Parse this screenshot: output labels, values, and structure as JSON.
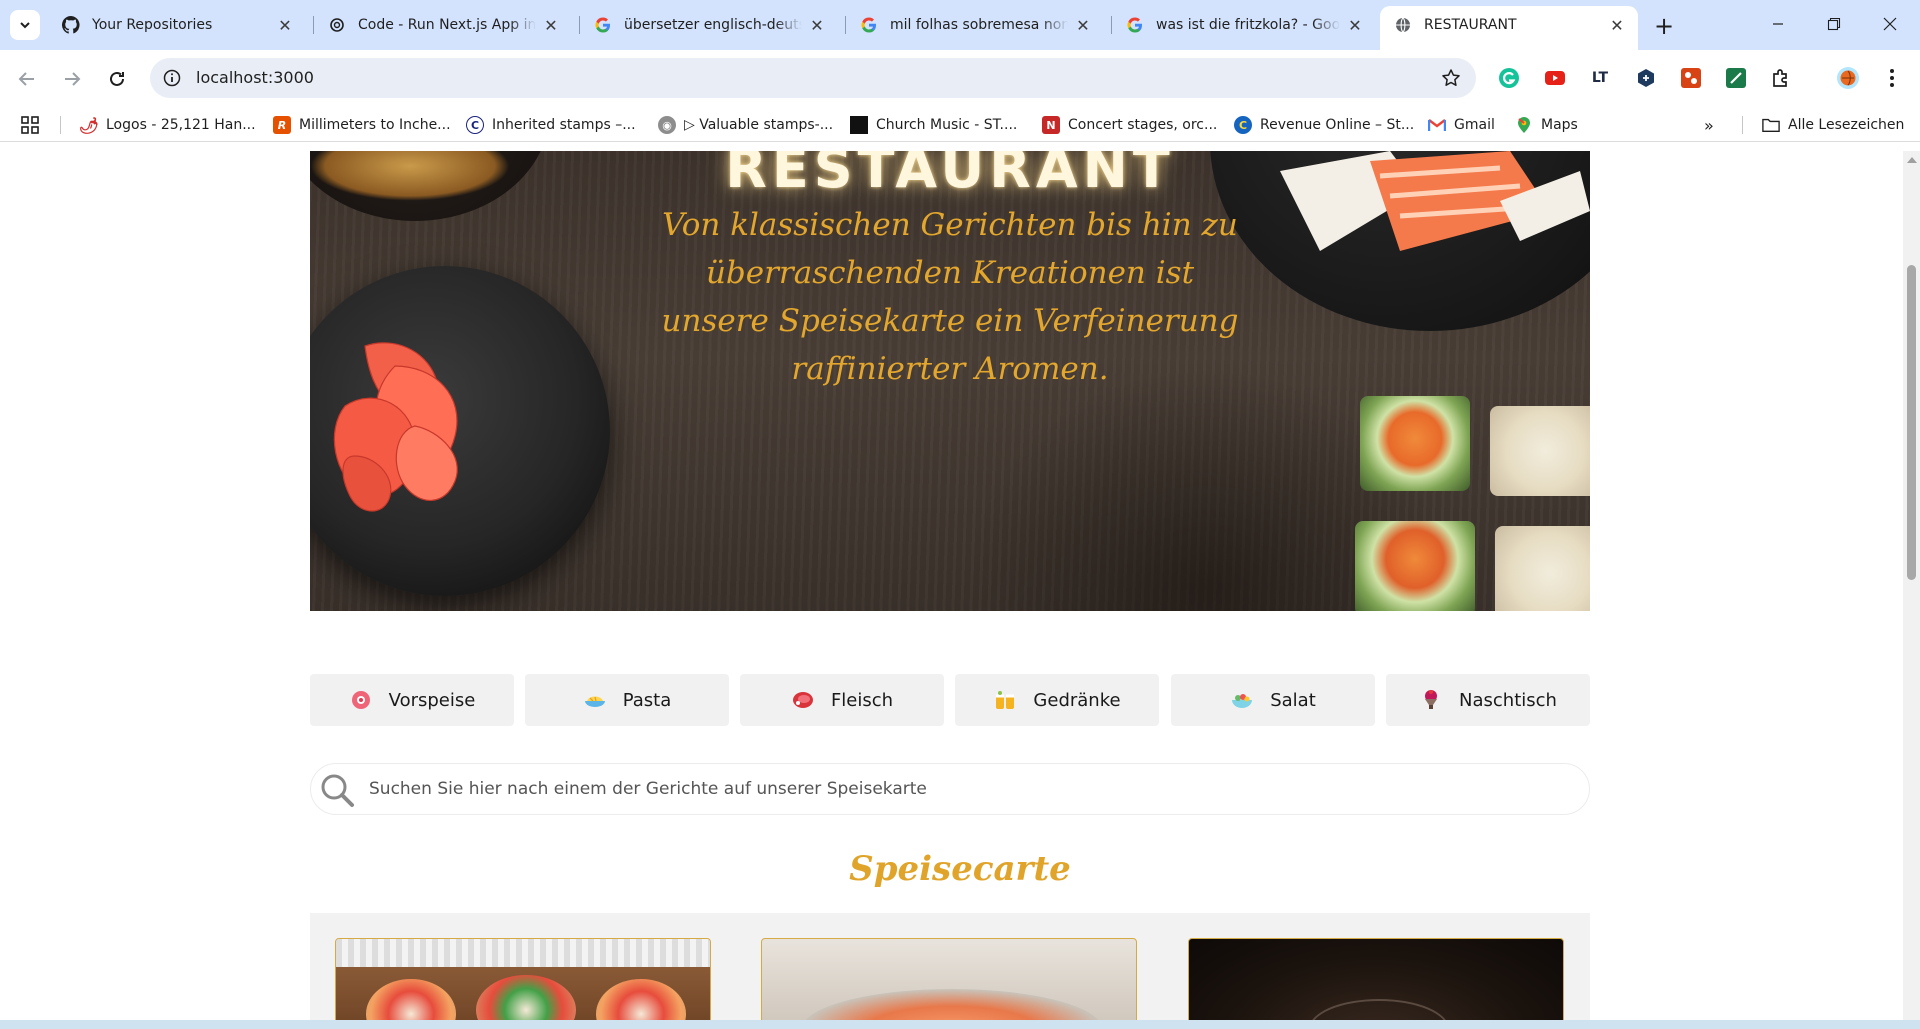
{
  "browser": {
    "tabs": [
      {
        "title": "Your Repositories",
        "icon": "github-icon"
      },
      {
        "title": "Code - Run Next.js App in VS Code",
        "icon": "chatgpt-icon"
      },
      {
        "title": "übersetzer englisch-deutsch",
        "icon": "google-icon"
      },
      {
        "title": "mil folhas sobremesa nome",
        "icon": "google-icon"
      },
      {
        "title": "was ist die fritzkola? - Google",
        "icon": "google-icon"
      },
      {
        "title": "RESTAURANT",
        "icon": "globe-icon",
        "active": true
      }
    ],
    "url": "localhost:3000",
    "bookmarks": [
      {
        "label": "Logos - 25,121 Han...",
        "icon": "chili-icon",
        "color": "#d32f2f"
      },
      {
        "label": "Millimeters to Inche...",
        "icon": "r-icon",
        "color": "#e65100"
      },
      {
        "label": "Inherited stamps –...",
        "icon": "stamp-icon",
        "color": "#1a237e"
      },
      {
        "label": "▷ Valuable stamps-...",
        "icon": "gear-icon",
        "color": "#6d6d6d"
      },
      {
        "label": "Church Music - ST....",
        "icon": "black-square-icon",
        "color": "#111111"
      },
      {
        "label": "Concert stages, orc...",
        "icon": "n-icon",
        "color": "#c62828"
      },
      {
        "label": "Revenue Online – St...",
        "icon": "colorado-icon",
        "color": "#1565c0"
      },
      {
        "label": "Gmail",
        "icon": "gmail-icon",
        "color": "#ea4335"
      },
      {
        "label": "Maps",
        "icon": "maps-icon",
        "color": "#34a853"
      }
    ],
    "all_bookmarks_label": "Alle Lesezeichen"
  },
  "hero": {
    "title": "RESTAURANT",
    "tagline": "Von klassischen Gerichten bis hin zu überraschenden Kreationen ist unsere Speisekarte ein Verfeinerung raffinierter Aromen."
  },
  "categories": [
    {
      "label": "Vorspeise",
      "icon": "appetizer-icon"
    },
    {
      "label": "Pasta",
      "icon": "pasta-icon"
    },
    {
      "label": "Fleisch",
      "icon": "meat-icon"
    },
    {
      "label": "Gedränke",
      "icon": "drinks-icon"
    },
    {
      "label": "Salat",
      "icon": "salad-icon"
    },
    {
      "label": "Naschtisch",
      "icon": "dessert-icon"
    }
  ],
  "search": {
    "placeholder": "Suchen Sie hier nach einem der Gerichte auf unserer Speisekarte"
  },
  "menu": {
    "heading": "Speisecarte"
  },
  "colors": {
    "accent": "#e0a42a",
    "card_border": "#d4aa45",
    "tab_strip": "#d3e3fd"
  }
}
